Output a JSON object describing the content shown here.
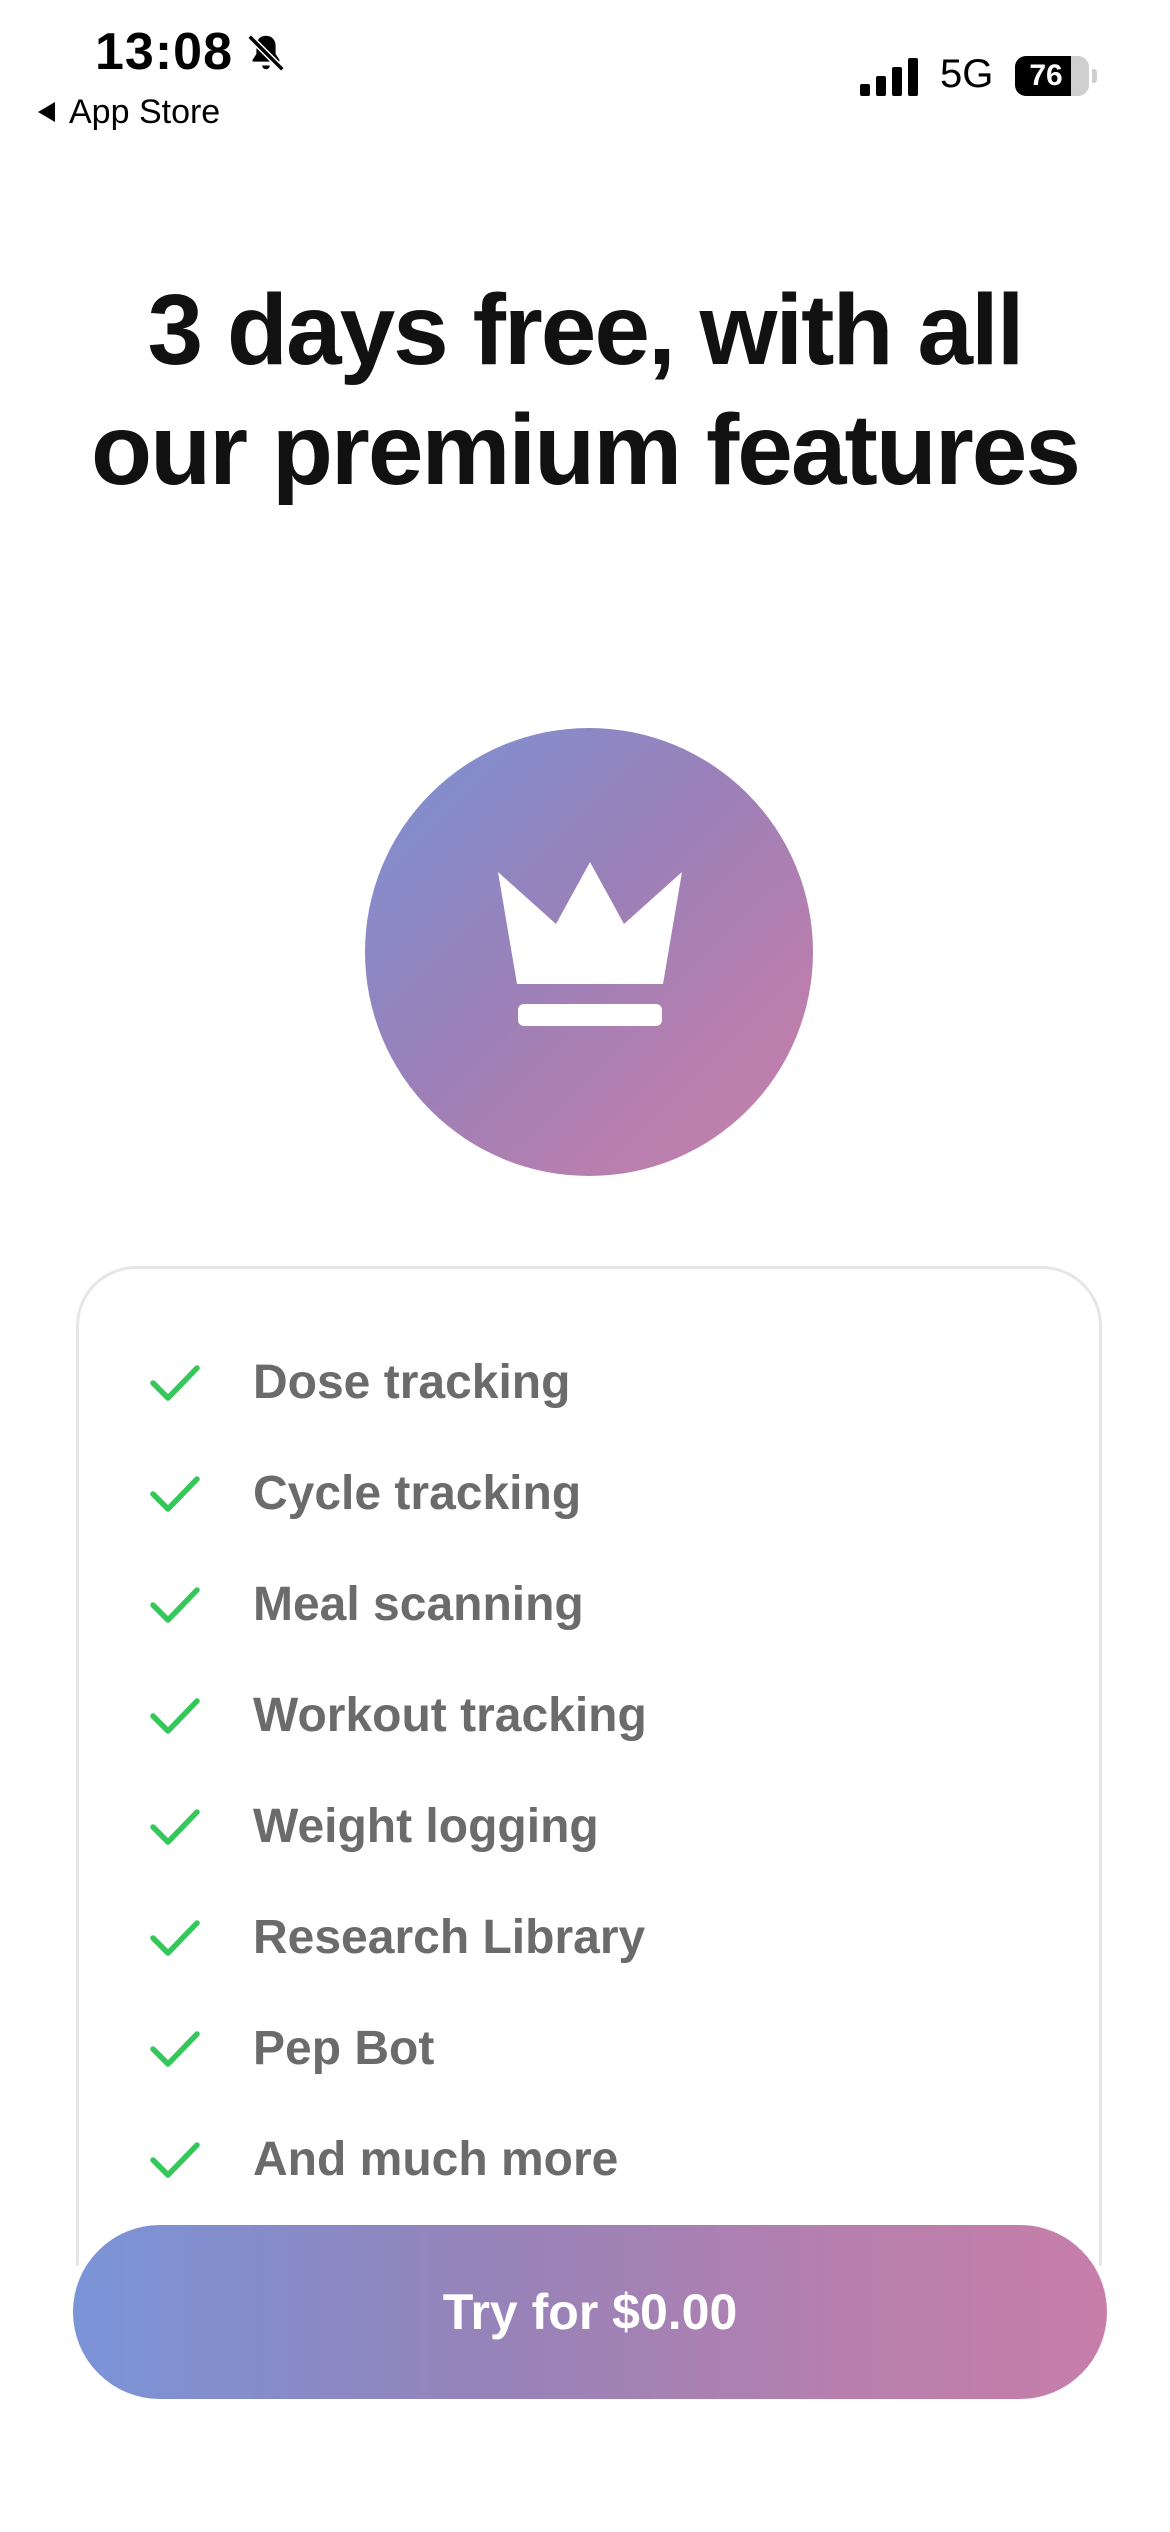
{
  "status_bar": {
    "time": "13:08",
    "back_label": "App Store",
    "network": "5G",
    "battery_percent": "76",
    "battery_level": 0.76,
    "icons": [
      "bell-slash-icon",
      "signal-bars-icon",
      "battery-icon"
    ]
  },
  "headline": "3 days free, with all our premium features",
  "hero_icon": "crown-icon",
  "colors": {
    "gradient_start": "#7a94d8",
    "gradient_end": "#c77ea9",
    "check_green": "#34c759",
    "feature_text": "#6b6b6b",
    "headline_text": "#111111"
  },
  "features": [
    {
      "label": "Dose tracking",
      "icon": "check-icon"
    },
    {
      "label": "Cycle tracking",
      "icon": "check-icon"
    },
    {
      "label": "Meal scanning",
      "icon": "check-icon"
    },
    {
      "label": "Workout tracking",
      "icon": "check-icon"
    },
    {
      "label": "Weight logging",
      "icon": "check-icon"
    },
    {
      "label": "Research Library",
      "icon": "check-icon"
    },
    {
      "label": "Pep Bot",
      "icon": "check-icon"
    },
    {
      "label": "And much more",
      "icon": "check-icon"
    }
  ],
  "cta": {
    "label": "Try for $0.00"
  }
}
